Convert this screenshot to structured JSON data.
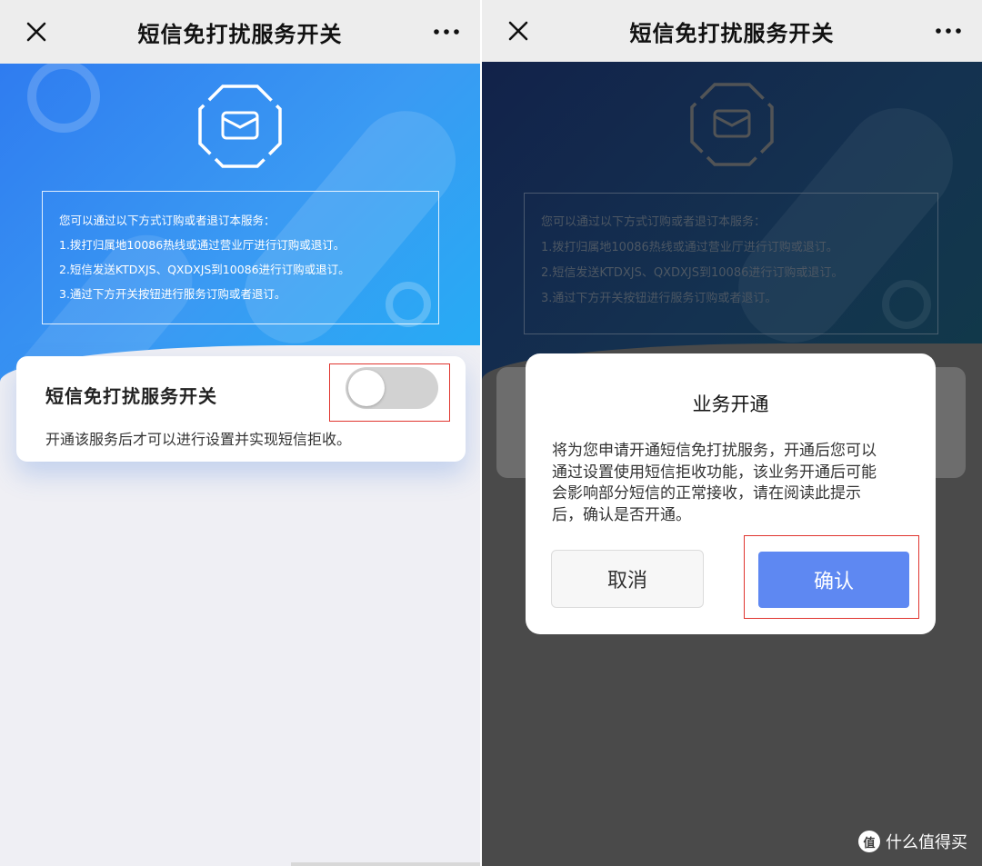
{
  "left": {
    "nav_title": "短信免打扰服务开关",
    "info_lines": [
      "您可以通过以下方式订购或者退订本服务：",
      "1.拨打归属地10086热线或通过营业厅进行订购或退订。",
      "2.短信发送KTDXJS、QXDXJS到10086进行订购或退订。",
      "3.通过下方开关按钮进行服务订购或者退订。"
    ],
    "setting_title": "短信免打扰服务开关",
    "setting_desc": "开通该服务后才可以进行设置并实现短信拒收。",
    "toggle_on": false
  },
  "right": {
    "nav_title": "短信免打扰服务开关",
    "info_lines": [
      "您可以通过以下方式订购或者退订本服务：",
      "1.拨打归属地10086热线或通过营业厅进行订购或退订。",
      "2.短信发送KTDXJS、QXDXJS到10086进行订购或退订。",
      "3.通过下方开关按钮进行服务订购或者退订。"
    ],
    "dialog": {
      "title": "业务开通",
      "body_lines": [
        "将为您申请开通短信免打扰服务，开通后您可以",
        "通过设置使用短信拒收功能，该业务开通后可能",
        "会影响部分短信的正常接收，请在阅读此提示",
        "后，确认是否开通。"
      ],
      "cancel_label": "取消",
      "confirm_label": "确认"
    }
  },
  "watermark": {
    "badge": "值",
    "text": "什么值得买"
  },
  "colors": {
    "accent_blue": "#5e88f2",
    "highlight_red": "#e0352f",
    "hero_blue": "#2f7cf0"
  }
}
